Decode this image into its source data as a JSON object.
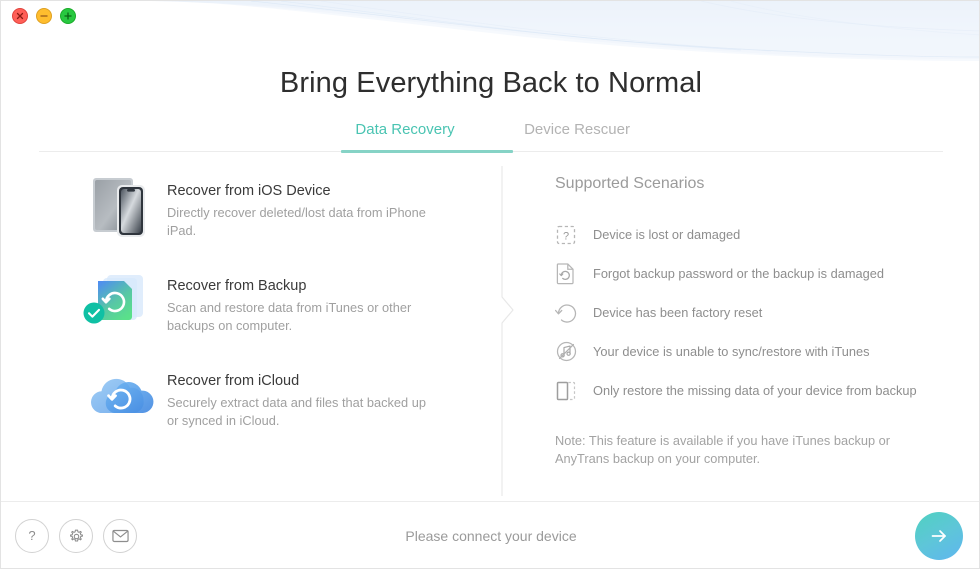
{
  "window": {
    "controls": [
      {
        "name": "close",
        "color": "#ff5f57"
      },
      {
        "name": "minimize",
        "color": "#ffbd2e"
      },
      {
        "name": "maximize",
        "color": "#28c840"
      }
    ]
  },
  "header": {
    "title": "Bring Everything Back to Normal"
  },
  "tabs": [
    {
      "label": "Data Recovery",
      "active": true
    },
    {
      "label": "Device Rescuer",
      "active": false
    }
  ],
  "theme": {
    "accent": "#4ac4b2",
    "accent_underline": "#86d3c6",
    "muted_text": "#a0a0a0",
    "title_text": "#2e2e2e"
  },
  "options": [
    {
      "icon": "ios-device-icon",
      "title": "Recover from iOS Device",
      "desc": "Directly recover deleted/lost data from iPhone iPad.",
      "selected": false
    },
    {
      "icon": "backup-folder-icon",
      "title": "Recover from Backup",
      "desc": "Scan and restore data from iTunes or other backups on computer.",
      "selected": true
    },
    {
      "icon": "icloud-icon",
      "title": "Recover from iCloud",
      "desc": "Securely extract data and files that backed up or synced in iCloud.",
      "selected": false
    }
  ],
  "scenarios": {
    "title": "Supported Scenarios",
    "items": [
      {
        "icon": "dashed-question-box-icon",
        "label": "Device is lost or damaged"
      },
      {
        "icon": "document-restore-icon",
        "label": "Forgot backup password or the backup is damaged"
      },
      {
        "icon": "factory-reset-icon",
        "label": "Device has been factory reset"
      },
      {
        "icon": "itunes-sync-disabled-icon",
        "label": "Your device is unable to sync/restore with iTunes"
      },
      {
        "icon": "partial-restore-icon",
        "label": "Only restore the missing data of your device from backup"
      }
    ],
    "note": "Note: This feature is available if you have iTunes backup or AnyTrans backup on your computer."
  },
  "footer": {
    "buttons": [
      {
        "icon": "help-icon",
        "name": "help-button"
      },
      {
        "icon": "gear-icon",
        "name": "settings-button"
      },
      {
        "icon": "mail-icon",
        "name": "feedback-button"
      }
    ],
    "status": "Please connect your device",
    "next": {
      "icon": "arrow-right-icon",
      "name": "next-button"
    }
  }
}
